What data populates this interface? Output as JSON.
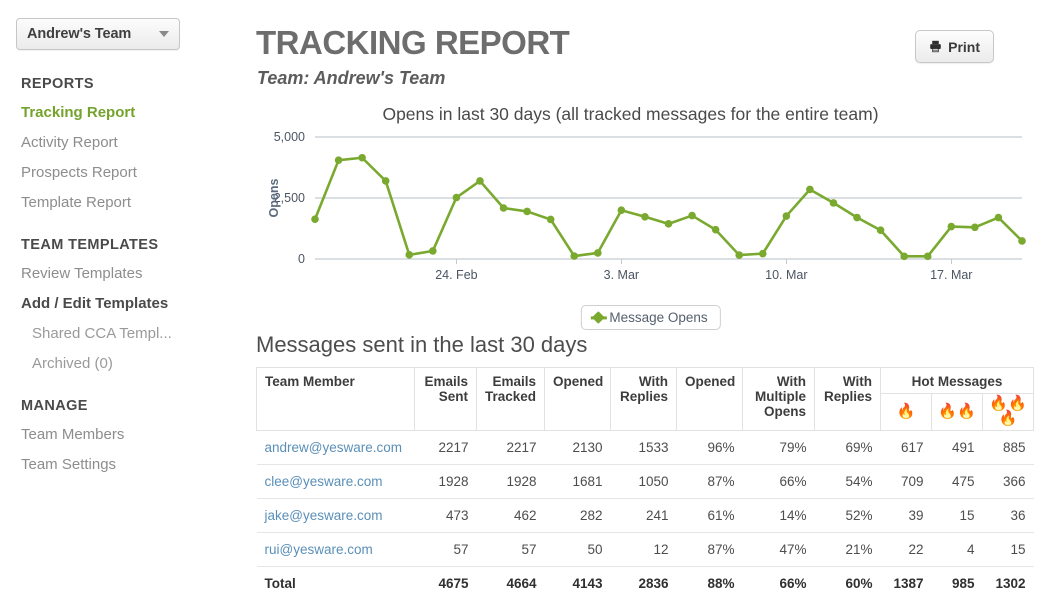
{
  "sidebar": {
    "team_switcher": {
      "label": "Andrew's Team",
      "icon": "chevron-down-icon"
    },
    "sections": [
      {
        "heading": "REPORTS",
        "items": [
          {
            "label": "Tracking Report",
            "state": "active"
          },
          {
            "label": "Activity Report",
            "state": "normal"
          },
          {
            "label": "Prospects Report",
            "state": "normal"
          },
          {
            "label": "Template Report",
            "state": "normal"
          }
        ]
      },
      {
        "heading": "TEAM TEMPLATES",
        "items": [
          {
            "label": "Review Templates",
            "state": "normal"
          },
          {
            "label": "Add / Edit Templates",
            "state": "bold"
          },
          {
            "label": "Shared CCA Templ...",
            "state": "sub"
          },
          {
            "label": "Archived (0)",
            "state": "sub"
          }
        ]
      },
      {
        "heading": "MANAGE",
        "items": [
          {
            "label": "Team Members",
            "state": "normal"
          },
          {
            "label": "Team Settings",
            "state": "normal"
          }
        ]
      }
    ]
  },
  "header": {
    "title": "TRACKING REPORT",
    "subtitle": "Team: Andrew's Team",
    "print_label": "Print",
    "print_icon": "printer-icon"
  },
  "chart_data": {
    "type": "line",
    "title": "Opens in last 30 days (all tracked messages for the entire team)",
    "xlabel": "",
    "ylabel": "Opens",
    "ylim": [
      0,
      5000
    ],
    "yticks": [
      0,
      2500,
      5000
    ],
    "ytick_labels": [
      "0",
      "2,500",
      "5,000"
    ],
    "grid": true,
    "legend_position": "bottom",
    "legend": [
      "Message Opens"
    ],
    "series_color": "#7aa930",
    "xtick_labels": [
      "24. Feb",
      "3. Mar",
      "10. Mar",
      "17. Mar"
    ],
    "xtick_indices": [
      6,
      13,
      20,
      27
    ],
    "x": [
      "18. Feb",
      "19. Feb",
      "20. Feb",
      "21. Feb",
      "22. Feb",
      "23. Feb",
      "24. Feb",
      "25. Feb",
      "26. Feb",
      "27. Feb",
      "28. Feb",
      "1. Mar",
      "2. Mar",
      "3. Mar",
      "4. Mar",
      "5. Mar",
      "6. Mar",
      "7. Mar",
      "8. Mar",
      "9. Mar",
      "10. Mar",
      "11. Mar",
      "12. Mar",
      "13. Mar",
      "14. Mar",
      "15. Mar",
      "16. Mar",
      "17. Mar",
      "18. Mar",
      "19. Mar",
      "20. Mar"
    ],
    "series": [
      {
        "name": "Message Opens",
        "values": [
          1630,
          4050,
          4150,
          3200,
          170,
          330,
          2520,
          3200,
          2090,
          1950,
          1620,
          120,
          250,
          2000,
          1730,
          1440,
          1780,
          1200,
          160,
          220,
          1760,
          2850,
          2300,
          1700,
          1180,
          110,
          110,
          1330,
          1300,
          1700,
          740
        ]
      }
    ]
  },
  "table": {
    "heading": "Messages sent in the last 30 days",
    "group_header": {
      "label": "Hot Messages"
    },
    "columns": [
      "Team Member",
      "Emails Sent",
      "Emails Tracked",
      "Opened",
      "With Replies",
      "Opened",
      "With Multiple Opens",
      "With Replies"
    ],
    "flame_columns": [
      "🔥",
      "🔥🔥",
      "🔥🔥🔥"
    ],
    "rows": [
      {
        "member": "andrew@yesware.com",
        "cells": [
          "2217",
          "2217",
          "2130",
          "1533",
          "96%",
          "79%",
          "69%",
          "617",
          "491",
          "885"
        ]
      },
      {
        "member": "clee@yesware.com",
        "cells": [
          "1928",
          "1928",
          "1681",
          "1050",
          "87%",
          "66%",
          "54%",
          "709",
          "475",
          "366"
        ]
      },
      {
        "member": "jake@yesware.com",
        "cells": [
          "473",
          "462",
          "282",
          "241",
          "61%",
          "14%",
          "52%",
          "39",
          "15",
          "36"
        ]
      },
      {
        "member": "rui@yesware.com",
        "cells": [
          "57",
          "57",
          "50",
          "12",
          "87%",
          "47%",
          "21%",
          "22",
          "4",
          "15"
        ]
      }
    ],
    "total_row": {
      "member": "Total",
      "cells": [
        "4675",
        "4664",
        "4143",
        "2836",
        "88%",
        "66%",
        "60%",
        "1387",
        "985",
        "1302"
      ]
    }
  }
}
